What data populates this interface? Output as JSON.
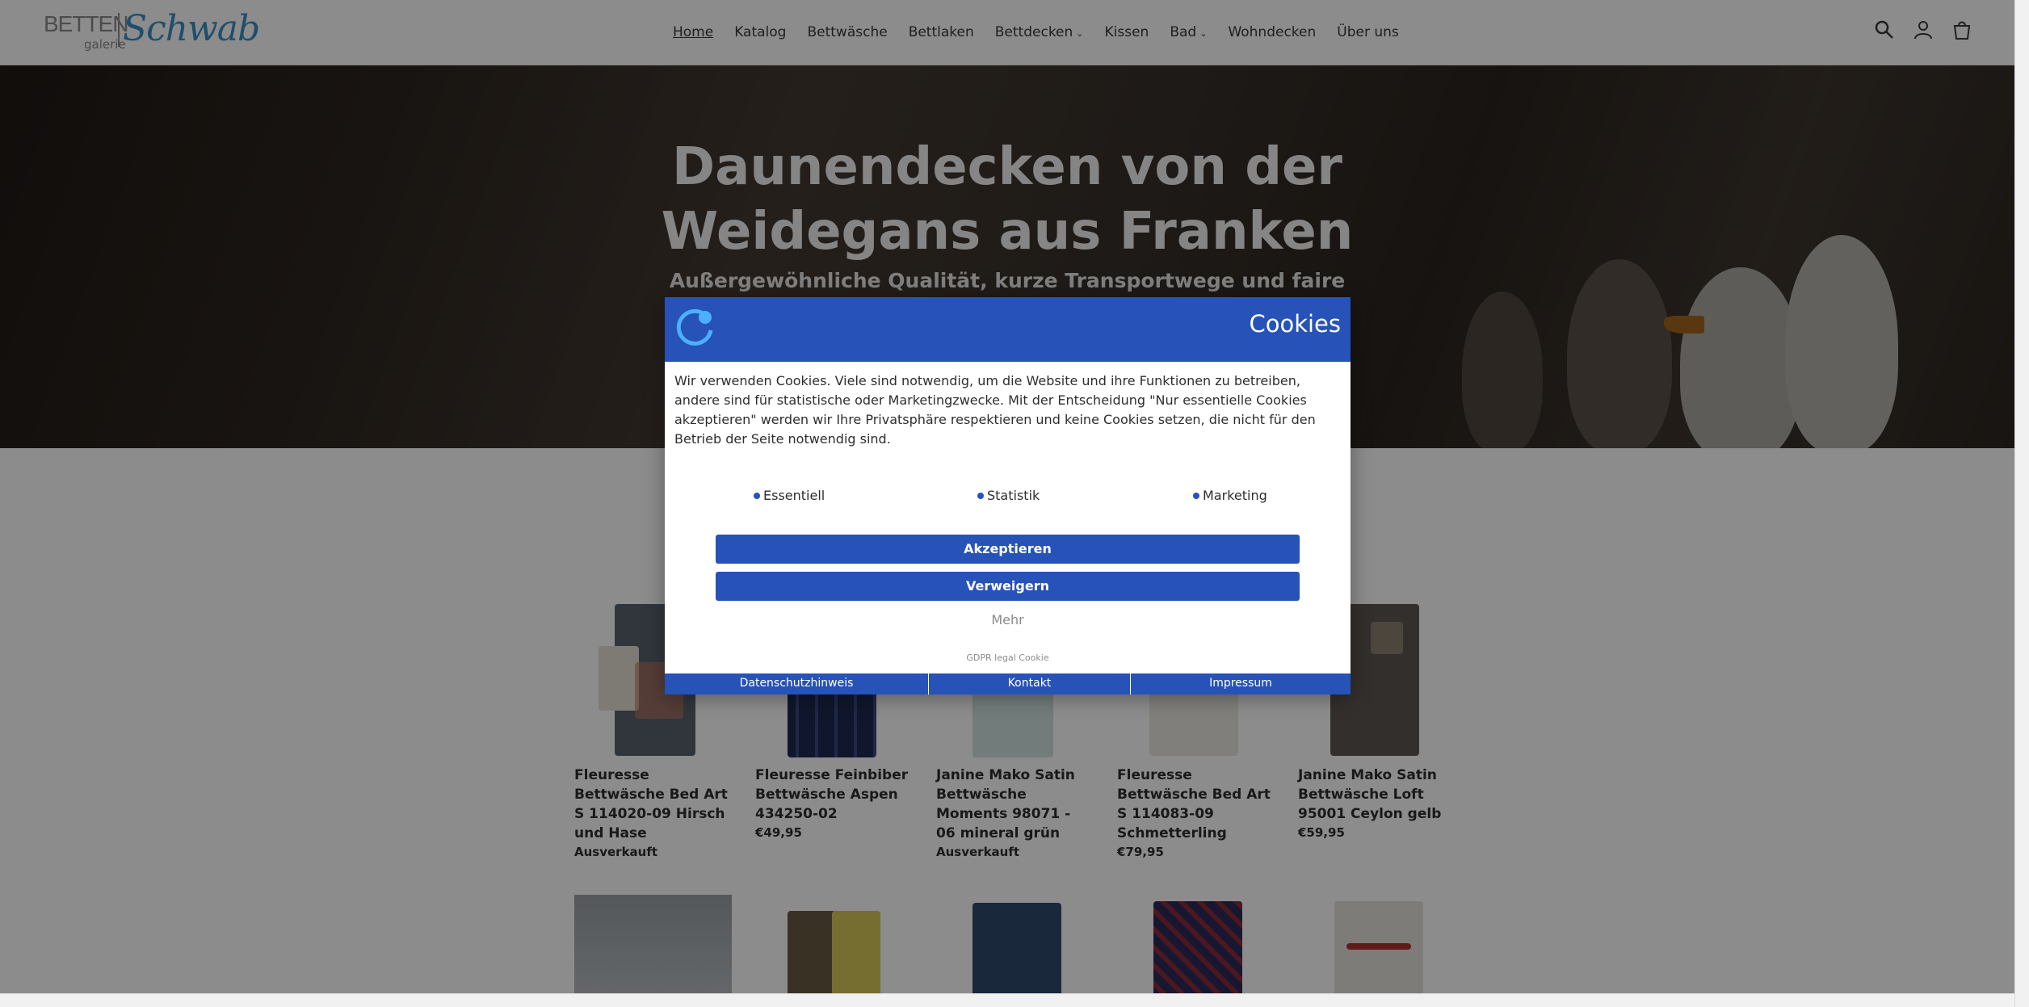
{
  "header": {
    "logo": {
      "line1": "BETTEN",
      "line2": "galerie",
      "script": "Schwab"
    },
    "nav": [
      {
        "label": "Home",
        "active": true
      },
      {
        "label": "Katalog"
      },
      {
        "label": "Bettwäsche"
      },
      {
        "label": "Bettlaken"
      },
      {
        "label": "Bettdecken",
        "dropdown": true
      },
      {
        "label": "Kissen"
      },
      {
        "label": "Bad",
        "dropdown": true
      },
      {
        "label": "Wohndecken"
      },
      {
        "label": "Über uns"
      }
    ],
    "icons": [
      "search-icon",
      "account-icon",
      "cart-icon"
    ]
  },
  "hero": {
    "title_line1": "Daunendecken von der",
    "title_line2": "Weidegans aus Franken",
    "subtitle": "Außergewöhnliche Qualität, kurze Transportwege und faire"
  },
  "products": [
    {
      "name": "Fleuresse Bettwäsche Bed Art S 114020-09 Hirsch und Hase",
      "status": "Ausverkauft"
    },
    {
      "name": "Fleuresse Feinbiber Bettwäsche Aspen 434250-02",
      "price": "€49,95"
    },
    {
      "name": "Janine Mako Satin Bettwäsche Moments 98071 - 06 mineral grün",
      "status": "Ausverkauft"
    },
    {
      "name": "Fleuresse Bettwäsche Bed Art S 114083-09 Schmetterling",
      "price": "€79,95"
    },
    {
      "name": "Janine Mako Satin Bettwäsche Loft 95001 Ceylon gelb",
      "price": "€59,95"
    }
  ],
  "cookie": {
    "title": "Cookies",
    "text": "Wir verwenden Cookies. Viele sind notwendig, um die Website und ihre Funktionen zu betreiben, andere sind für statistische oder Marketingzwecke. Mit der Entscheidung \"Nur essentielle Cookies akzeptieren\" werden wir Ihre Privatsphäre respektieren und keine Cookies setzen, die nicht für den Betrieb der Seite notwendig sind.",
    "categories": [
      "Essentiell",
      "Statistik",
      "Marketing"
    ],
    "accept": "Akzeptieren",
    "deny": "Verweigern",
    "more": "Mehr",
    "gdpr": "GDPR legal Cookie",
    "footer": [
      "Datenschutzhinweis",
      "Kontakt",
      "Impressum"
    ],
    "accent": "#2752b8"
  }
}
